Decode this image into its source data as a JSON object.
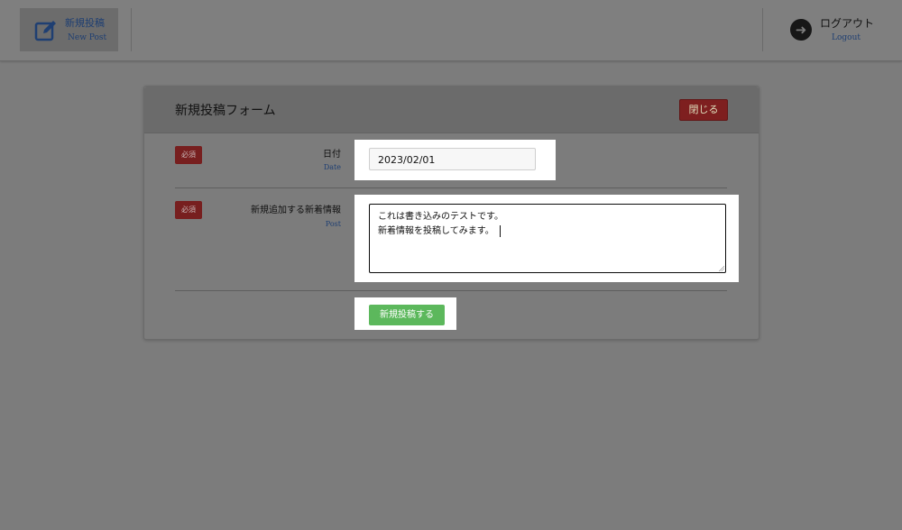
{
  "topbar": {
    "new_post": {
      "label_jp": "新規投稿",
      "label_en": "New Post",
      "icon": "edit-icon"
    },
    "logout": {
      "label_jp": "ログアウト",
      "label_en": "Logout",
      "icon": "arrow-right-circle-icon"
    }
  },
  "form": {
    "title": "新規投稿フォーム",
    "close_label": "閉じる",
    "date_row": {
      "badge": "必須",
      "label": "日付",
      "sub_label": "Date",
      "value": "2023/02/01"
    },
    "post_row": {
      "badge": "必須",
      "label": "新規追加する新着情報",
      "sub_label": "Post",
      "line1": "これは書き込みのテストです。",
      "line2": "新着情報を投稿してみます。"
    },
    "submit_label": "新規投稿する"
  },
  "colors": {
    "accent_blue": "#1f3f72",
    "danger_red": "#7e1f1f",
    "success_green": "#5cb85c"
  }
}
